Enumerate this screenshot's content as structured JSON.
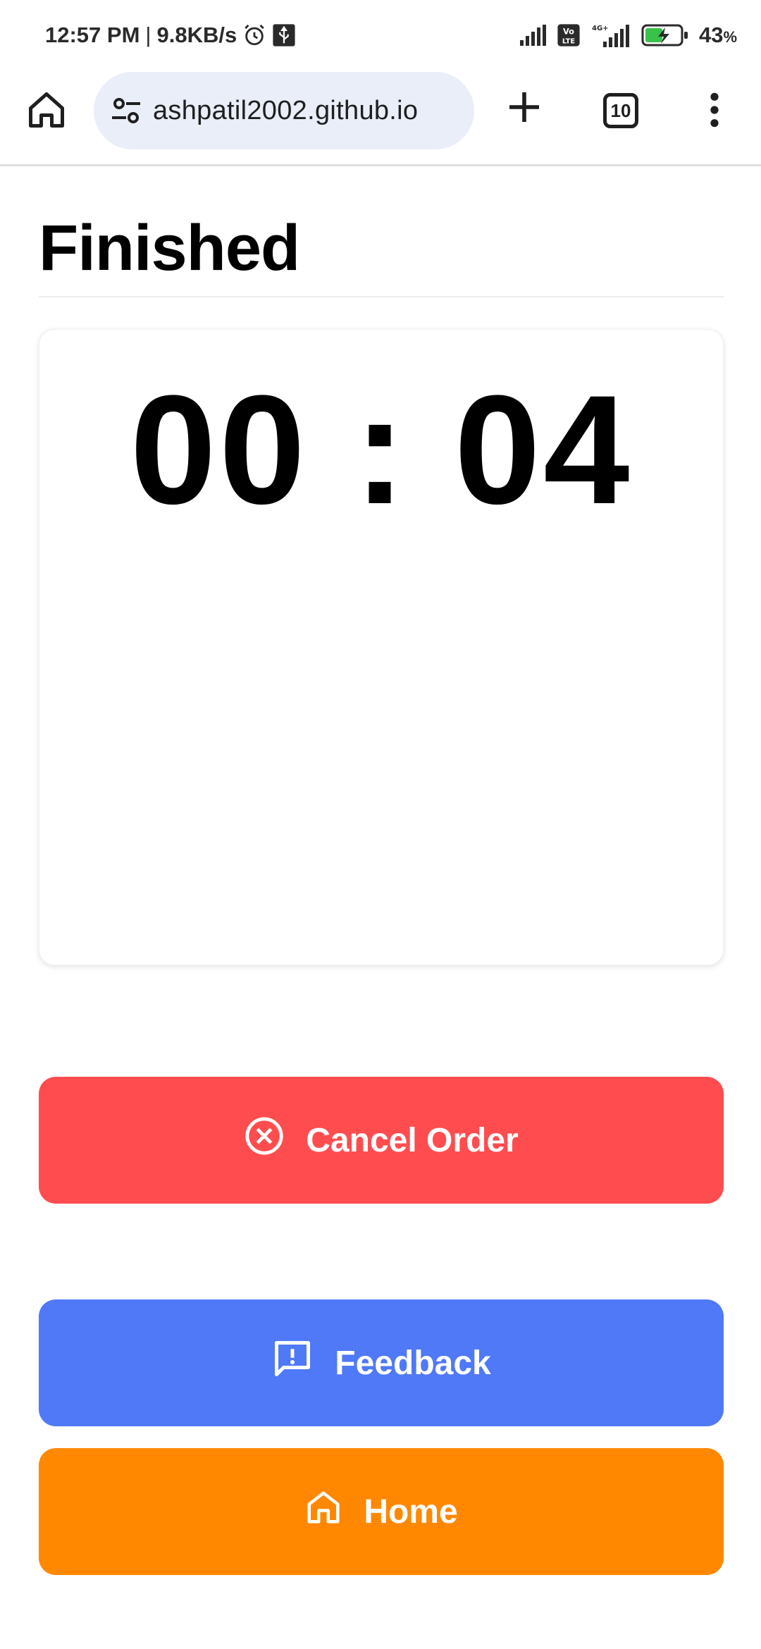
{
  "status_bar": {
    "time": "12:57 PM",
    "separator": "|",
    "speed": "9.8KB/s",
    "battery": "43",
    "battery_unit": "%"
  },
  "browser": {
    "url": "ashpatil2002.github.io",
    "tab_count": "10"
  },
  "page": {
    "title": "Finished",
    "timer": "00 : 04"
  },
  "buttons": {
    "cancel": {
      "label": "Cancel Order",
      "color": "#ff4d4f",
      "icon": "cancel-circle-icon"
    },
    "feedback": {
      "label": "Feedback",
      "color": "#4f79f7",
      "icon": "feedback-icon"
    },
    "home": {
      "label": "Home",
      "color": "#ff8800",
      "icon": "home-icon"
    }
  }
}
